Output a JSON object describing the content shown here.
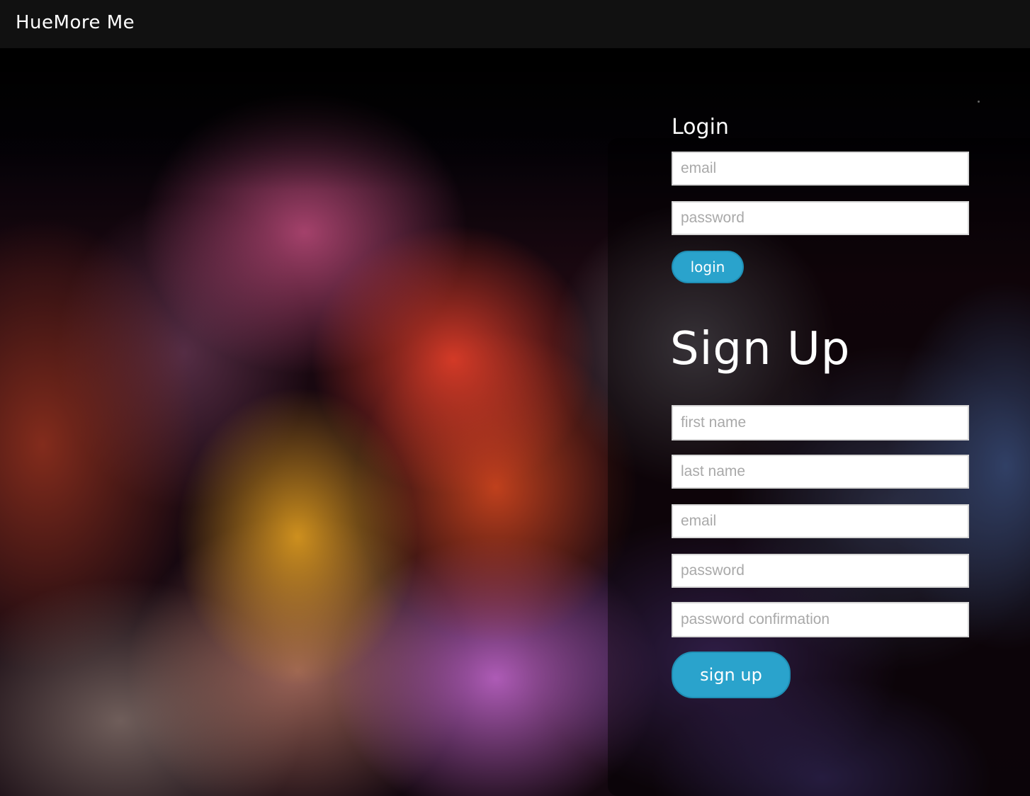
{
  "navbar": {
    "brand": "HueMore Me",
    "color": "#111111"
  },
  "login": {
    "heading": "Login",
    "email_placeholder": "email",
    "password_placeholder": "password",
    "button_label": "login"
  },
  "signup": {
    "heading": "Sign Up",
    "first_name_placeholder": "first name",
    "last_name_placeholder": "last name",
    "email_placeholder": "email",
    "password_placeholder": "password",
    "password_confirmation_placeholder": "password confirmation",
    "button_label": "sign up"
  },
  "colors": {
    "button": "#2aa3cc",
    "button_border": "#1f8fb5",
    "text": "#ffffff"
  }
}
